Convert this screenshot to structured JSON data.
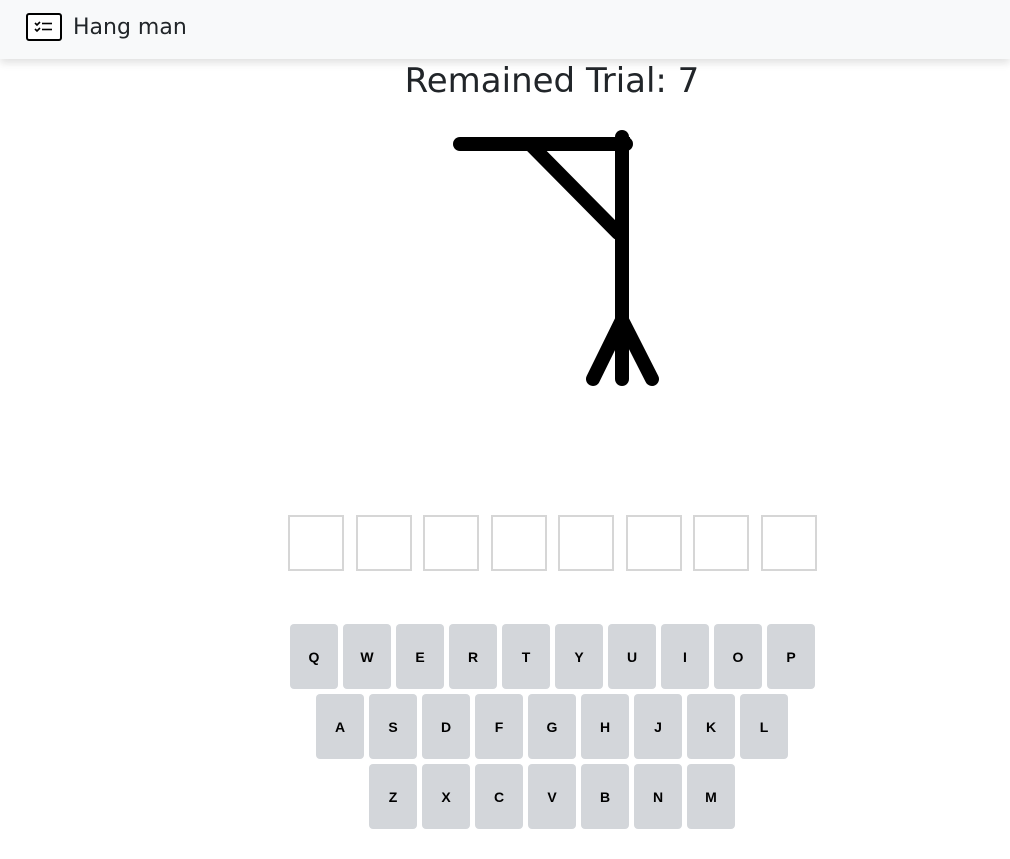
{
  "navbar": {
    "brand_label": "Hang man",
    "brand_icon": "checklist-card-icon"
  },
  "game": {
    "trial_label": "Remained Trial: 7",
    "remaining_trials": 7,
    "word_slots": [
      "",
      "",
      "",
      "",
      "",
      "",
      "",
      ""
    ]
  },
  "keyboard": {
    "rows": [
      [
        "Q",
        "W",
        "E",
        "R",
        "T",
        "Y",
        "U",
        "I",
        "O",
        "P"
      ],
      [
        "A",
        "S",
        "D",
        "F",
        "G",
        "H",
        "J",
        "K",
        "L"
      ],
      [
        "Z",
        "X",
        "C",
        "V",
        "B",
        "N",
        "M"
      ]
    ],
    "key_color": "#d3d6da"
  }
}
